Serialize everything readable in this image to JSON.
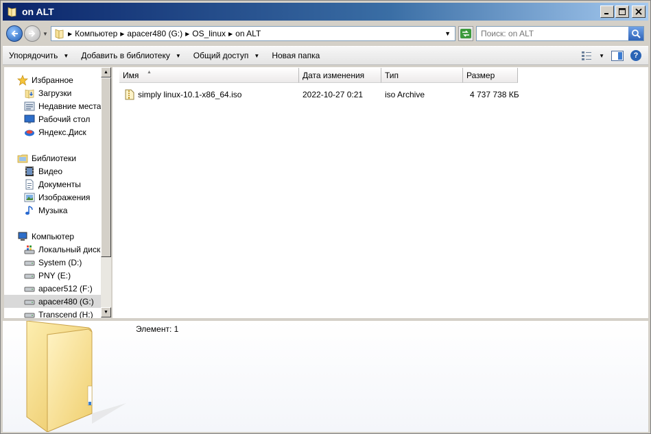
{
  "window": {
    "title": "on ALT"
  },
  "address": {
    "crumbs": [
      "Компьютер",
      "apacer480 (G:)",
      "OS_linux",
      "on ALT"
    ]
  },
  "search": {
    "placeholder": "Поиск: on ALT"
  },
  "toolbar": {
    "organize": "Упорядочить",
    "add_to_library": "Добавить в библиотеку",
    "share": "Общий доступ",
    "new_folder": "Новая папка"
  },
  "sidebar": {
    "favorites": {
      "label": "Избранное",
      "items": [
        "Загрузки",
        "Недавние места",
        "Рабочий стол",
        "Яндекс.Диск"
      ]
    },
    "libraries": {
      "label": "Библиотеки",
      "items": [
        "Видео",
        "Документы",
        "Изображения",
        "Музыка"
      ]
    },
    "computer": {
      "label": "Компьютер",
      "items": [
        "Локальный диск (",
        "System (D:)",
        "PNY (E:)",
        "apacer512 (F:)",
        "apacer480 (G:)",
        "Transcend (H:)"
      ]
    }
  },
  "columns": [
    "Имя",
    "Дата изменения",
    "Тип",
    "Размер"
  ],
  "files": [
    {
      "name": "simply linux-10.1-x86_64.iso",
      "modified": "2022-10-27 0:21",
      "type": "iso Archive",
      "size": "4 737 738 КБ"
    }
  ],
  "details": {
    "count": "Элемент: 1"
  },
  "colors": {
    "title_start": "#0a246a",
    "title_end": "#a6caf0",
    "folder": "#f3d77e"
  }
}
